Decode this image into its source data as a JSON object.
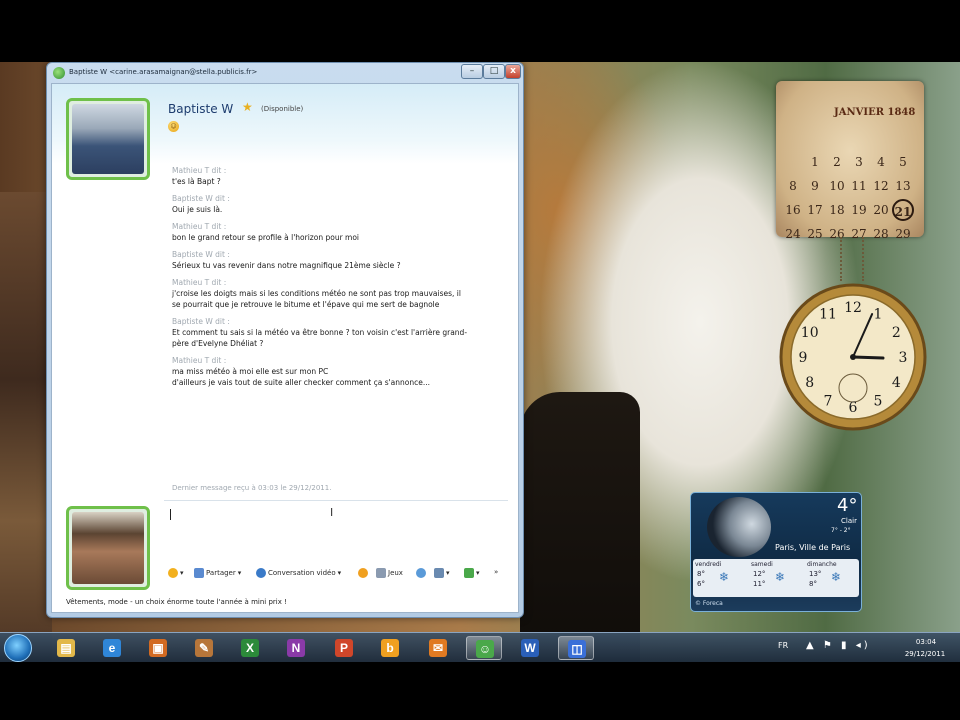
{
  "window": {
    "title": "Baptiste W <carine.arasamaignan@stella.publicis.fr>",
    "minimize": "–",
    "maximize": "□",
    "close": "x"
  },
  "contact": {
    "name": "Baptiste W",
    "status": "(Disponible)"
  },
  "messages": [
    {
      "sender": "Mathieu T dit :",
      "lines": [
        "t'es là Bapt ?"
      ]
    },
    {
      "sender": "Baptiste W dit :",
      "lines": [
        "Oui je suis là."
      ]
    },
    {
      "sender": "Mathieu T dit :",
      "lines": [
        "bon le grand retour se profile à l'horizon pour moi"
      ]
    },
    {
      "sender": "Baptiste W dit :",
      "lines": [
        "Sérieux tu vas revenir dans notre magnifique 21ème siècle ?"
      ]
    },
    {
      "sender": "Mathieu T dit :",
      "lines": [
        "j'croise les doigts mais si les conditions météo ne sont pas trop mauvaises, il",
        "se pourrait que je retrouve le bitume et l'épave qui me sert de bagnole"
      ]
    },
    {
      "sender": "Baptiste W dit :",
      "lines": [
        "Et comment tu sais si la météo va être bonne ? ton voisin c'est l'arrière grand-",
        "père d'Evelyne Dhéliat ?"
      ]
    },
    {
      "sender": "Mathieu T dit :",
      "lines": [
        "ma miss météo à moi elle est sur mon PC",
        "d'ailleurs je vais tout de suite aller checker comment ça s'annonce..."
      ]
    }
  ],
  "last_received": "Dernier message reçu à 03:03 le 29/12/2011.",
  "toolbar": {
    "share": "Partager",
    "video": "Conversation vidéo",
    "games": "Jeux",
    "more": "»"
  },
  "ad_text": "Vêtements, mode - un choix énorme toute l'année à mini prix !",
  "calendar": {
    "title": "JANVIER 1848",
    "days": [
      "",
      "",
      "",
      "",
      "",
      "",
      "",
      "1",
      "2",
      "3",
      "4",
      "5",
      "8",
      "9",
      "10",
      "11",
      "12",
      "13",
      "16",
      "17",
      "18",
      "19",
      "20",
      "21",
      "24",
      "25",
      "26",
      "27",
      "28",
      "29"
    ],
    "today": "21"
  },
  "clock": {
    "numerals": [
      "12",
      "1",
      "2",
      "3",
      "4",
      "5",
      "6",
      "7",
      "8",
      "9",
      "10",
      "11"
    ],
    "hour": 3,
    "minute": 4
  },
  "weather": {
    "temp": "4°",
    "condition": "Clair",
    "range": "7° - 2°",
    "city": "Paris, Ville de Paris",
    "forecast": [
      {
        "day": "vendredi",
        "hi": "8°",
        "lo": "6°"
      },
      {
        "day": "samedi",
        "hi": "12°",
        "lo": "11°"
      },
      {
        "day": "dimanche",
        "hi": "13°",
        "lo": "8°"
      }
    ],
    "source": "© Foreca"
  },
  "taskbar": {
    "apps": [
      {
        "name": "explorer",
        "glyph": "▤",
        "color": "#e2b84a"
      },
      {
        "name": "internet-explorer",
        "glyph": "e",
        "color": "#2f86d8"
      },
      {
        "name": "app-orange",
        "glyph": "▣",
        "color": "#d26a22"
      },
      {
        "name": "app-tools",
        "glyph": "✎",
        "color": "#b7763a"
      },
      {
        "name": "excel",
        "glyph": "X",
        "color": "#2c8a3a"
      },
      {
        "name": "onenote",
        "glyph": "N",
        "color": "#8a3aa8"
      },
      {
        "name": "powerpoint",
        "glyph": "P",
        "color": "#d0462a"
      },
      {
        "name": "app-b",
        "glyph": "b",
        "color": "#f0a020"
      },
      {
        "name": "app-mail",
        "glyph": "✉",
        "color": "#e07a22"
      },
      {
        "name": "messenger",
        "glyph": "☺",
        "color": "#4aa84a"
      },
      {
        "name": "word",
        "glyph": "W",
        "color": "#2a5fb8"
      },
      {
        "name": "app-blue",
        "glyph": "◫",
        "color": "#3a6fd8"
      }
    ],
    "lang": "FR",
    "tray": "▲ ⚑ ▮ ◂)",
    "time": "03:04",
    "date": "29/12/2011"
  },
  "colors": {
    "avatar_border": "#6fc04a",
    "contact_name": "#1d3c6e"
  }
}
